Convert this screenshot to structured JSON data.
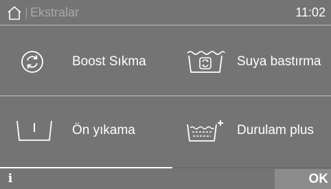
{
  "header": {
    "title": "Ekstralar",
    "time": "11:02",
    "home_icon": "home-icon"
  },
  "options": [
    {
      "label": "Boost Sıkma",
      "icon": "boost-spin-icon"
    },
    {
      "label": "Suya bastırma",
      "icon": "soak-icon"
    },
    {
      "label": "Ön yıkama",
      "icon": "prewash-icon"
    },
    {
      "label": "Durulam plus",
      "icon": "rinse-plus-icon"
    }
  ],
  "footer": {
    "info_label": "i",
    "ok_label": "OK",
    "progress_fraction": 0.52
  },
  "colors": {
    "background": "#747474",
    "text": "#ffffff",
    "muted_text": "#a9a9a9",
    "divider": "#c2c2c2",
    "ok_button": "#8c8c8c"
  }
}
